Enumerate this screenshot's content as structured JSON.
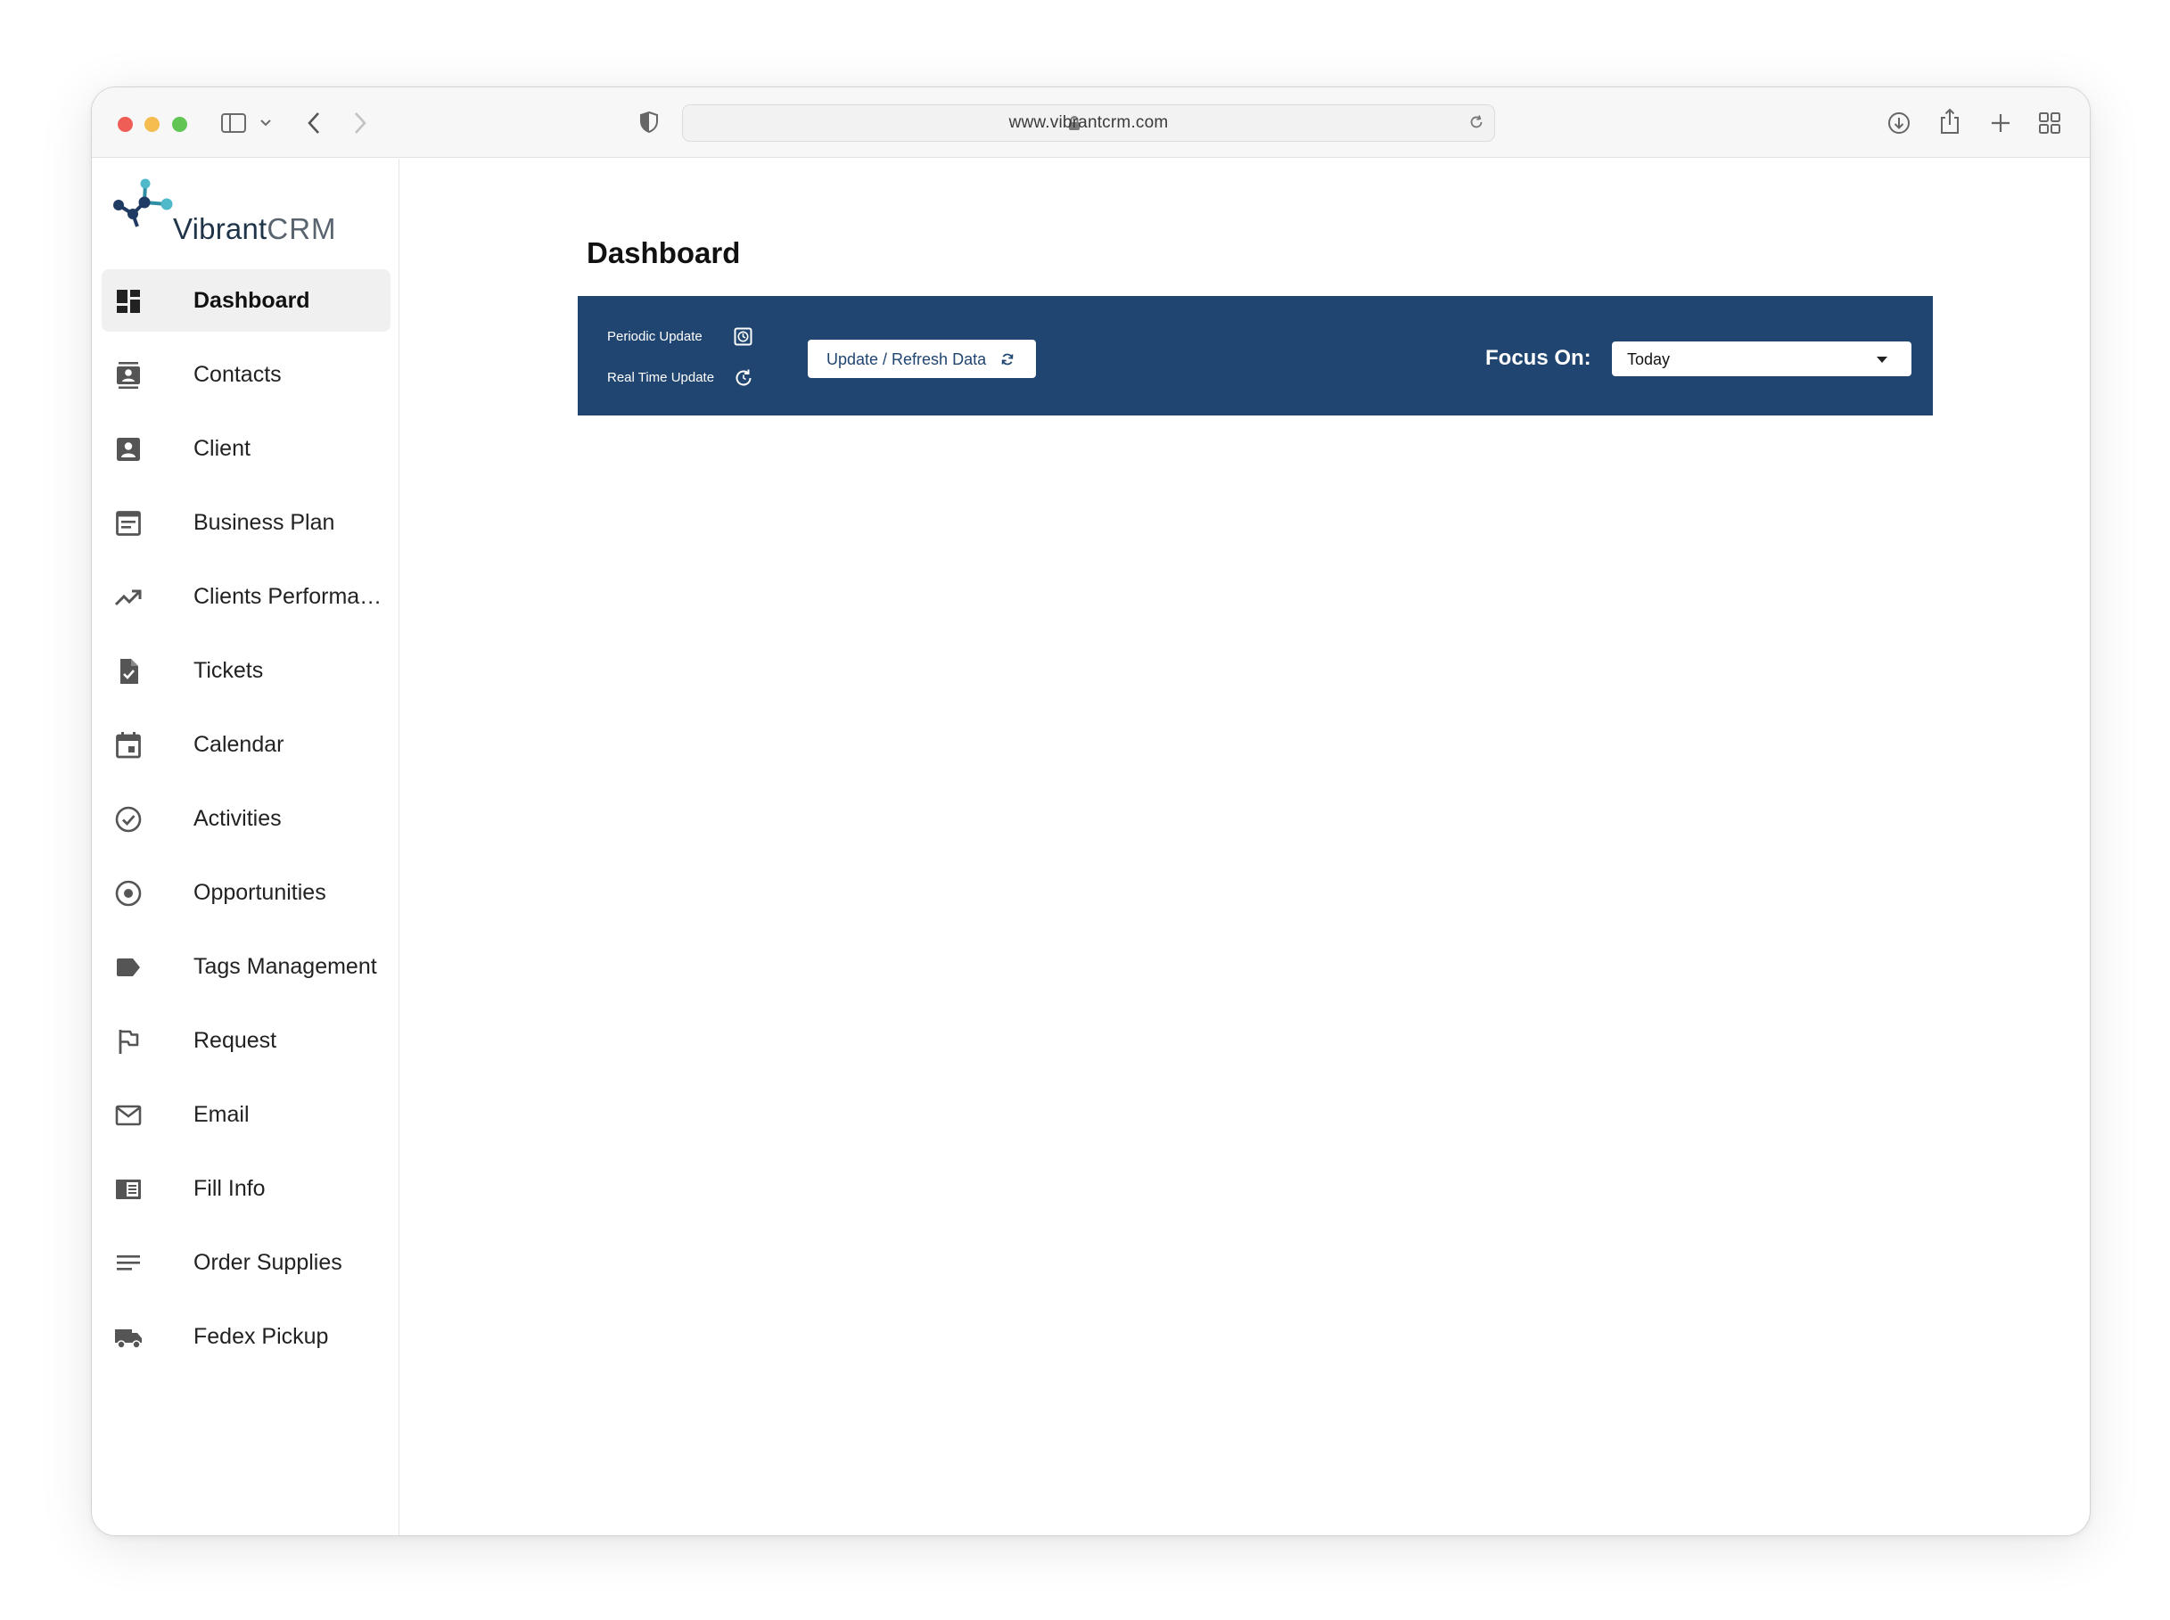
{
  "browser": {
    "url": "www.vibrantcrm.com"
  },
  "logo": {
    "name_bold": "Vibrant",
    "name_light": "CRM"
  },
  "sidebar": {
    "items": [
      {
        "label": "Dashboard",
        "icon": "dashboard-icon",
        "active": true
      },
      {
        "label": "Contacts",
        "icon": "contacts-icon"
      },
      {
        "label": "Client",
        "icon": "client-icon"
      },
      {
        "label": "Business Plan",
        "icon": "business-plan-icon"
      },
      {
        "label": "Clients Performance",
        "icon": "trending-up-icon"
      },
      {
        "label": "Tickets",
        "icon": "ticket-icon"
      },
      {
        "label": "Calendar",
        "icon": "calendar-icon"
      },
      {
        "label": "Activities",
        "icon": "check-circle-icon"
      },
      {
        "label": "Opportunities",
        "icon": "radio-target-icon"
      },
      {
        "label": "Tags Management",
        "icon": "tag-icon"
      },
      {
        "label": "Request",
        "icon": "flag-icon"
      },
      {
        "label": "Email",
        "icon": "mail-icon"
      },
      {
        "label": "Fill Info",
        "icon": "fill-info-icon"
      },
      {
        "label": "Order Supplies",
        "icon": "list-lines-icon"
      },
      {
        "label": "Fedex Pickup",
        "icon": "truck-icon"
      }
    ]
  },
  "main": {
    "title": "Dashboard",
    "bar": {
      "periodic_update": "Periodic Update",
      "real_time_update": "Real Time Update",
      "refresh_button": "Update / Refresh Data",
      "focus_label": "Focus On:",
      "focus_value": "Today"
    }
  },
  "colors": {
    "bar_background": "#204570",
    "active_nav_background": "#f0f0f0"
  }
}
